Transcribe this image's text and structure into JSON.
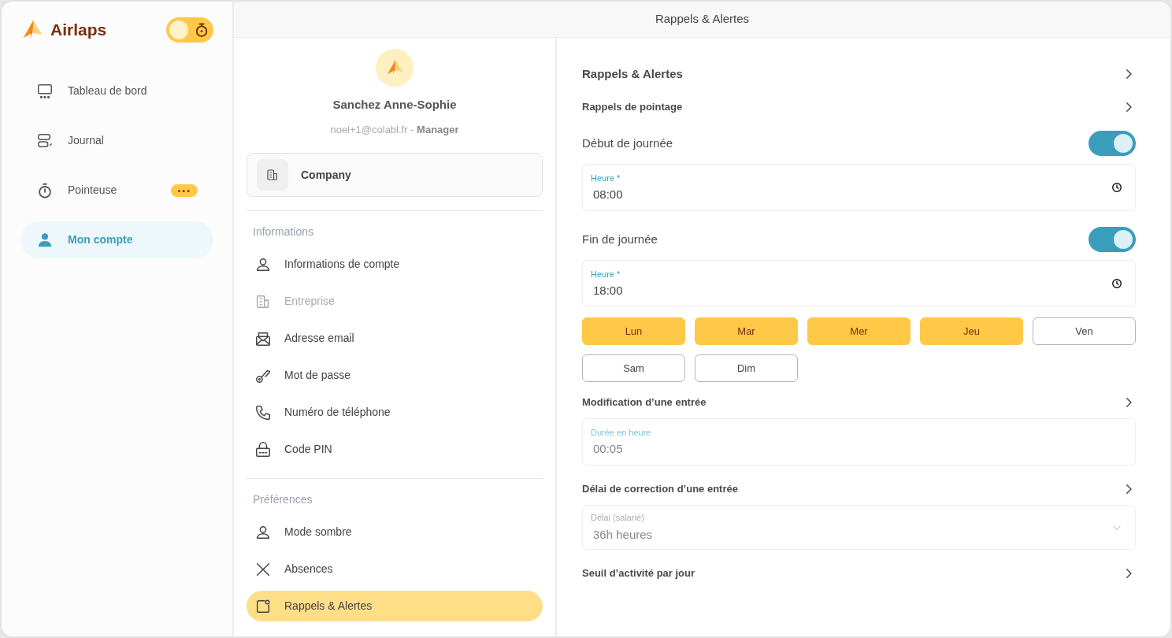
{
  "app": {
    "name": "Airlaps"
  },
  "sidebar": {
    "items": [
      {
        "label": "Tableau de bord",
        "selected": false
      },
      {
        "label": "Journal",
        "selected": false
      },
      {
        "label": "Pointeuse",
        "selected": false,
        "badge": "•••"
      },
      {
        "label": "Mon compte",
        "selected": true
      }
    ]
  },
  "header": {
    "title": "Rappels & Alertes"
  },
  "profile": {
    "name": "Sanchez Anne-Sophie",
    "email": "noel+1@colabl.fr",
    "separator": "-",
    "role": "Manager",
    "company": "Company"
  },
  "sections": [
    {
      "title": "Informations",
      "items": [
        {
          "label": "Informations de compte",
          "disabled": false,
          "selected": false
        },
        {
          "label": "Entreprise",
          "disabled": true,
          "selected": false
        },
        {
          "label": "Adresse email",
          "disabled": false,
          "selected": false
        },
        {
          "label": "Mot de passe",
          "disabled": false,
          "selected": false
        },
        {
          "label": "Numéro de téléphone",
          "disabled": false,
          "selected": false
        },
        {
          "label": "Code PIN",
          "disabled": false,
          "selected": false
        }
      ]
    },
    {
      "title": "Préférences",
      "items": [
        {
          "label": "Mode sombre",
          "disabled": false,
          "selected": false
        },
        {
          "label": "Absences",
          "disabled": false,
          "selected": false
        },
        {
          "label": "Rappels & Alertes",
          "disabled": false,
          "selected": true
        }
      ]
    }
  ],
  "panel": {
    "rows": [
      {
        "kind": "heading",
        "label": "Rappels & Alertes"
      },
      {
        "kind": "subheading",
        "label": "Rappels de pointage"
      },
      {
        "kind": "toggle",
        "label": "Début de journée",
        "on": true
      },
      {
        "kind": "time_field",
        "label": "Heure *",
        "value": "08:00"
      },
      {
        "kind": "toggle",
        "label": "Fin de journée",
        "on": true
      },
      {
        "kind": "time_field",
        "label": "Heure *",
        "value": "18:00"
      },
      {
        "kind": "days",
        "days": [
          {
            "label": "Lun",
            "selected": true
          },
          {
            "label": "Mar",
            "selected": true
          },
          {
            "label": "Mer",
            "selected": true
          },
          {
            "label": "Jeu",
            "selected": true
          },
          {
            "label": "Ven",
            "selected": false
          },
          {
            "label": "Sam",
            "selected": false
          },
          {
            "label": "Dim",
            "selected": false
          }
        ]
      },
      {
        "kind": "subheading",
        "label": "Modification d’une entrée"
      },
      {
        "kind": "readonly_field",
        "label": "Durée en heure",
        "value": "00:05"
      },
      {
        "kind": "subheading",
        "label": "Délai de correction d’une entrée"
      },
      {
        "kind": "select",
        "label": "Délai (salarié)",
        "value": "36h heures"
      },
      {
        "kind": "subheading",
        "label": "Seuil d’activité par jour"
      }
    ]
  }
}
